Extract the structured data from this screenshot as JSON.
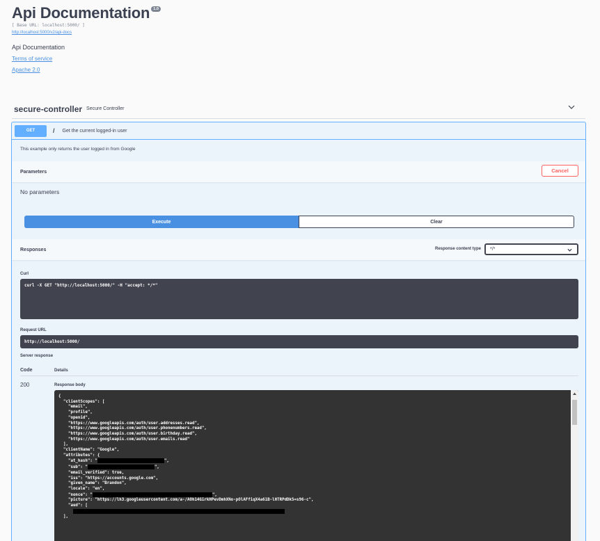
{
  "info": {
    "title": "Api Documentation",
    "version": "1.0",
    "base_url": "[ Base URL: localhost:5000/ ]",
    "docs_link": "http://localhost:5000/v2/api-docs",
    "description": "Api Documentation",
    "terms_link": "Terms of service",
    "license_link": "Apache 2.0"
  },
  "tag": {
    "name": "secure-controller",
    "description": "Secure Controller",
    "collapse_icon": "chevron-down-icon"
  },
  "operation": {
    "method": "GET",
    "path": "/",
    "summary": "Get the current logged-in user",
    "description": "This example only returns the user logged in from Google",
    "color": "#61affe"
  },
  "parameters": {
    "title": "Parameters",
    "cancel_label": "Cancel",
    "empty_text": "No parameters"
  },
  "actions": {
    "execute_label": "Execute",
    "clear_label": "Clear"
  },
  "responses": {
    "title": "Responses",
    "content_type_label": "Response content type",
    "content_type_value": "*/*",
    "curl_label": "Curl",
    "curl_command": "curl -X GET \"http://localhost:5000/\" -H \"accept: */*\"",
    "request_url_label": "Request URL",
    "request_url": "http://localhost:5000/",
    "server_response_label": "Server response",
    "code_header": "Code",
    "details_header": "Details",
    "code": "200",
    "response_body_label": "Response body",
    "body_lines": [
      "{",
      "  \"clientScopes\": [",
      "    \"email\",",
      "    \"profile\",",
      "    \"openid\",",
      "    \"https://www.googleapis.com/auth/user.addresses.read\",",
      "    \"https://www.googleapis.com/auth/user.phonenumbers.read\",",
      "    \"https://www.googleapis.com/auth/user.birthday.read\",",
      "    \"https://www.googleapis.com/auth/user.emails.read\"",
      "  ],",
      "  \"clientName\": \"Google\",",
      "  \"attributes\": {",
      "    \"at_hash\": \"",
      "    \"sub\": \"",
      "    \"email_verified\": true,",
      "    \"iss\": \"https://accounts.google.com\",",
      "    \"given_name\": \"Brandon\",",
      "    \"locale\": \"en\",",
      "    \"nonce\": \"",
      "    \"picture\": \"https://lh3.googleusercontent.com/a-/AOh14GirkHPevDmhXNo-pOlAFfiqX4a61B-lHTRPdDk5=s96-c\",",
      "    \"aud\": [",
      "",
      "  ],"
    ]
  }
}
